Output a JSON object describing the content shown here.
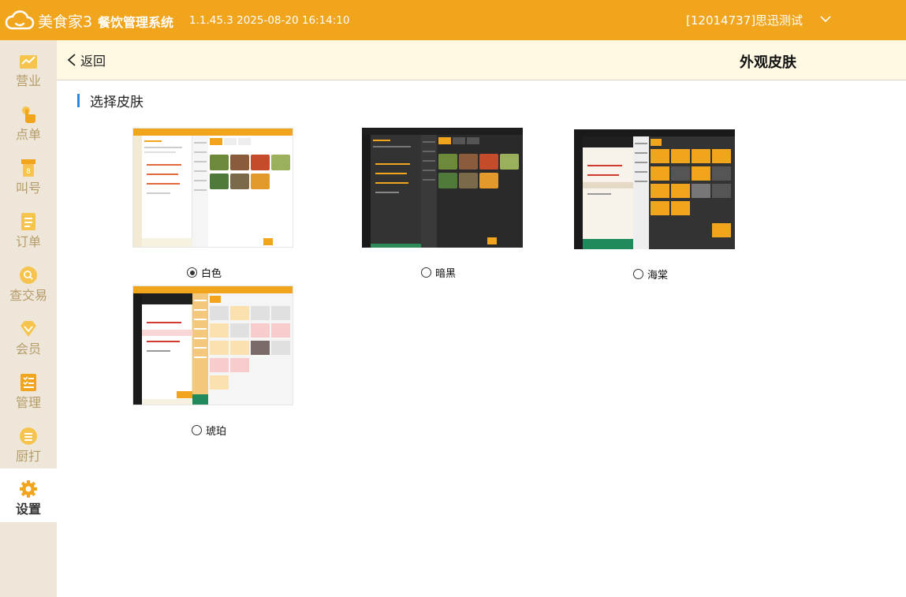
{
  "header": {
    "logo_text": "美食家3",
    "system_title": "餐饮管理系统",
    "version_info": "1.1.45.3 2025-08-20 16:14:10",
    "account": "[12014737]思迅测试"
  },
  "sidebar": {
    "items": [
      {
        "label": "营业",
        "icon": "business-icon"
      },
      {
        "label": "点单",
        "icon": "order-hand-icon"
      },
      {
        "label": "叫号",
        "icon": "call-number-icon"
      },
      {
        "label": "订单",
        "icon": "order-list-icon"
      },
      {
        "label": "查交易",
        "icon": "search-transaction-icon"
      },
      {
        "label": "会员",
        "icon": "member-diamond-icon"
      },
      {
        "label": "管理",
        "icon": "manage-list-icon"
      },
      {
        "label": "厨打",
        "icon": "kitchen-print-icon"
      },
      {
        "label": "设置",
        "icon": "gear-icon",
        "active": true
      }
    ]
  },
  "subheader": {
    "back_label": "返回",
    "page_title": "外观皮肤"
  },
  "content": {
    "section_title": "选择皮肤",
    "skins": [
      {
        "label": "白色",
        "selected": true,
        "theme": "white"
      },
      {
        "label": "暗黑",
        "selected": false,
        "theme": "dark"
      },
      {
        "label": "海棠",
        "selected": false,
        "theme": "haitang"
      },
      {
        "label": "琥珀",
        "selected": false,
        "theme": "amber"
      }
    ]
  },
  "colors": {
    "brand": "#f0a51c",
    "sidebar_bg": "#eee7d9",
    "sidebar_label": "#b59b6a",
    "section_accent": "#2b88e0",
    "subheader_bg": "#fff9e3"
  }
}
